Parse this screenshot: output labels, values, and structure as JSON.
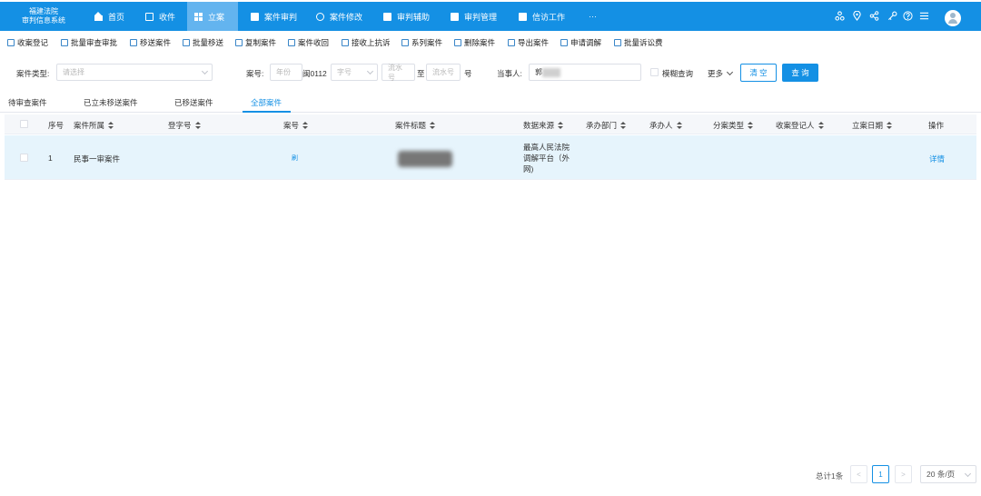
{
  "app": {
    "title_line1": "福建法院",
    "title_line2": "审判信息系统"
  },
  "nav": {
    "items": [
      {
        "label": "首页"
      },
      {
        "label": "收件"
      },
      {
        "label": "立案"
      },
      {
        "label": "案件审判"
      },
      {
        "label": "案件修改"
      },
      {
        "label": "审判辅助"
      },
      {
        "label": "审判管理"
      },
      {
        "label": "信访工作"
      },
      {
        "label": "···"
      }
    ],
    "active_index": 2,
    "tool_icons": [
      "org-icon",
      "location-icon",
      "share-icon",
      "key-icon",
      "help-icon",
      "menu-icon"
    ]
  },
  "toolbar": {
    "items": [
      {
        "label": "收案登记"
      },
      {
        "label": "批量审查审批"
      },
      {
        "label": "移送案件"
      },
      {
        "label": "批量移送"
      },
      {
        "label": "复制案件"
      },
      {
        "label": "案件收回"
      },
      {
        "label": "接收上抗诉"
      },
      {
        "label": "系列案件"
      },
      {
        "label": "删除案件"
      },
      {
        "label": "导出案件"
      },
      {
        "label": "申请调解"
      },
      {
        "label": "批量诉讼费"
      }
    ]
  },
  "filter": {
    "case_type_label": "案件类型:",
    "case_type_placeholder": "请选择",
    "case_no_label": "案号:",
    "year_placeholder": "年份",
    "court_code": "闽0112",
    "word_placeholder": "字号",
    "serial_placeholder": "流水号",
    "to_label": "至",
    "suffix_label": "号",
    "party_label": "当事人:",
    "party_value": "郭",
    "fuzzy_label": "模糊查询",
    "more_label": "更多",
    "clear_label": "清 空",
    "search_label": "查 询"
  },
  "tabs": {
    "items": [
      {
        "label": "待审查案件"
      },
      {
        "label": "已立未移送案件"
      },
      {
        "label": "已移送案件"
      },
      {
        "label": "全部案件"
      }
    ],
    "active_index": 3
  },
  "table": {
    "columns": [
      "序号",
      "案件所属",
      "登字号",
      "案号",
      "案件标题",
      "数据来源",
      "承办部门",
      "承办人",
      "分案类型",
      "收案登记人",
      "立案日期",
      "操作"
    ],
    "rows": [
      {
        "index": "1",
        "category": "民事一审案件",
        "reg_no": "",
        "case_no": "刷",
        "title": "",
        "source_line1": "最高人民法院",
        "source_line2": "调解平台（外",
        "source_line3": "网)",
        "dept": "",
        "handler": "",
        "type": "",
        "registrar": "",
        "date": "",
        "action": "详情"
      }
    ]
  },
  "pagination": {
    "total": "总计1条",
    "current_page": "1",
    "prev": "<",
    "next": ">",
    "page_size": "20 条/页"
  }
}
